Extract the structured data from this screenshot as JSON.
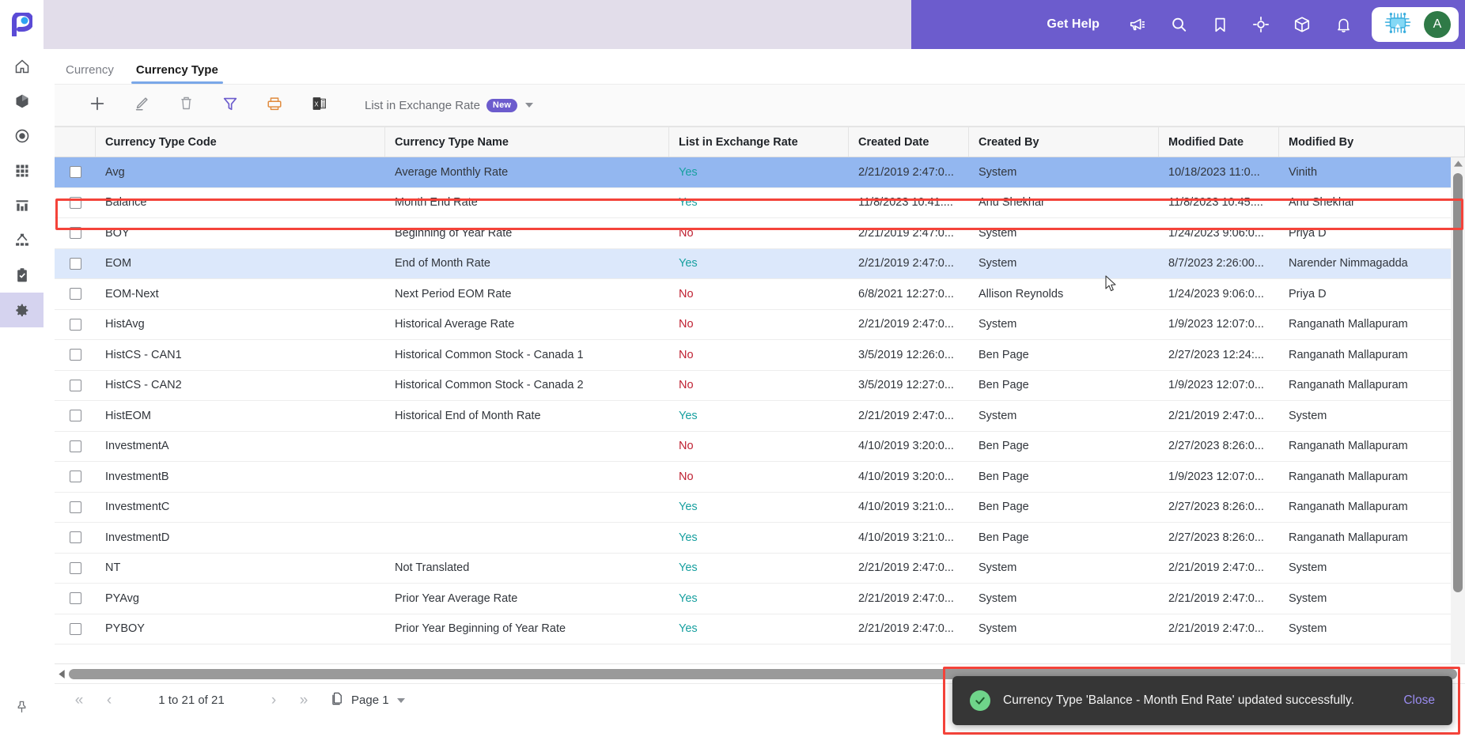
{
  "app": {
    "logo": "p-logo",
    "sidebar": {
      "items": [
        {
          "name": "home",
          "icon": "home-icon"
        },
        {
          "name": "cube",
          "icon": "cube-icon"
        },
        {
          "name": "target",
          "icon": "target-icon"
        },
        {
          "name": "grid",
          "icon": "grid-icon"
        },
        {
          "name": "reports",
          "icon": "bar-chart-icon"
        },
        {
          "name": "hierarchy",
          "icon": "hierarchy-icon"
        },
        {
          "name": "tasks",
          "icon": "clipboard-check-icon"
        },
        {
          "name": "settings",
          "icon": "gear-icon",
          "active": true
        }
      ],
      "pin": "pin-icon"
    }
  },
  "header": {
    "get_help": "Get Help",
    "icons": [
      "megaphone-icon",
      "search-icon",
      "bookmark-icon",
      "target-crosshair-icon",
      "box-icon",
      "bell-icon"
    ],
    "assistant_icon": "ai-chip-icon",
    "avatar_initial": "A",
    "accent": "#6c5ccd",
    "band": "#e2ddea",
    "avatar_color": "#2f7a47"
  },
  "tabs": [
    {
      "label": "Currency",
      "active": false
    },
    {
      "label": "Currency Type",
      "active": true
    }
  ],
  "toolbar": {
    "buttons": [
      {
        "name": "add",
        "icon": "plus-icon"
      },
      {
        "name": "edit",
        "icon": "pencil-icon"
      },
      {
        "name": "delete",
        "icon": "trash-icon"
      },
      {
        "name": "filter",
        "icon": "funnel-icon"
      },
      {
        "name": "print",
        "icon": "printer-icon"
      },
      {
        "name": "export-excel",
        "icon": "excel-icon"
      }
    ],
    "view_label": "List in Exchange Rate",
    "view_badge": "New"
  },
  "grid": {
    "columns": [
      {
        "key": "check",
        "label": ""
      },
      {
        "key": "code",
        "label": "Currency Type Code"
      },
      {
        "key": "name",
        "label": "Currency Type Name"
      },
      {
        "key": "list",
        "label": "List in Exchange Rate"
      },
      {
        "key": "cdate",
        "label": "Created Date"
      },
      {
        "key": "cby",
        "label": "Created By"
      },
      {
        "key": "mdate",
        "label": "Modified Date"
      },
      {
        "key": "mby",
        "label": "Modified By"
      }
    ],
    "rows": [
      {
        "code": "Avg",
        "name": "Average Monthly Rate",
        "list": "Yes",
        "cdate": "2/21/2019 2:47:0...",
        "cby": "System",
        "mdate": "10/18/2023 11:0...",
        "mby": "Vinith",
        "state": "selected-strong"
      },
      {
        "code": "Balance",
        "name": "Month End Rate",
        "list": "Yes",
        "cdate": "11/8/2023 10:41:...",
        "cby": "Anu Shekhar",
        "mdate": "11/8/2023 10:45:...",
        "mby": "Anu Shekhar",
        "state": "highlighted"
      },
      {
        "code": "BOY",
        "name": "Beginning of Year Rate",
        "list": "No",
        "cdate": "2/21/2019 2:47:0...",
        "cby": "System",
        "mdate": "1/24/2023 9:06:0...",
        "mby": "Priya D",
        "state": "normal"
      },
      {
        "code": "EOM",
        "name": "End of Month Rate",
        "list": "Yes",
        "cdate": "2/21/2019 2:47:0...",
        "cby": "System",
        "mdate": "8/7/2023 2:26:00...",
        "mby": "Narender Nimmagadda",
        "state": "selected-light"
      },
      {
        "code": "EOM-Next",
        "name": "Next Period EOM Rate",
        "list": "No",
        "cdate": "6/8/2021 12:27:0...",
        "cby": "Allison Reynolds",
        "mdate": "1/24/2023 9:06:0...",
        "mby": "Priya D",
        "state": "normal"
      },
      {
        "code": "HistAvg",
        "name": "Historical Average Rate",
        "list": "No",
        "cdate": "2/21/2019 2:47:0...",
        "cby": "System",
        "mdate": "1/9/2023 12:07:0...",
        "mby": "Ranganath Mallapuram",
        "state": "normal"
      },
      {
        "code": "HistCS - CAN1",
        "name": "Historical Common Stock - Canada 1",
        "list": "No",
        "cdate": "3/5/2019 12:26:0...",
        "cby": "Ben Page",
        "mdate": "2/27/2023 12:24:...",
        "mby": "Ranganath Mallapuram",
        "state": "normal"
      },
      {
        "code": "HistCS - CAN2",
        "name": "Historical Common Stock - Canada 2",
        "list": "No",
        "cdate": "3/5/2019 12:27:0...",
        "cby": "Ben Page",
        "mdate": "1/9/2023 12:07:0...",
        "mby": "Ranganath Mallapuram",
        "state": "normal"
      },
      {
        "code": "HistEOM",
        "name": "Historical End of Month Rate",
        "list": "Yes",
        "cdate": "2/21/2019 2:47:0...",
        "cby": "System",
        "mdate": "2/21/2019 2:47:0...",
        "mby": "System",
        "state": "normal"
      },
      {
        "code": "InvestmentA",
        "name": "",
        "list": "No",
        "cdate": "4/10/2019 3:20:0...",
        "cby": "Ben Page",
        "mdate": "2/27/2023 8:26:0...",
        "mby": "Ranganath Mallapuram",
        "state": "normal"
      },
      {
        "code": "InvestmentB",
        "name": "",
        "list": "No",
        "cdate": "4/10/2019 3:20:0...",
        "cby": "Ben Page",
        "mdate": "1/9/2023 12:07:0...",
        "mby": "Ranganath Mallapuram",
        "state": "normal"
      },
      {
        "code": "InvestmentC",
        "name": "",
        "list": "Yes",
        "cdate": "4/10/2019 3:21:0...",
        "cby": "Ben Page",
        "mdate": "2/27/2023 8:26:0...",
        "mby": "Ranganath Mallapuram",
        "state": "normal"
      },
      {
        "code": "InvestmentD",
        "name": "",
        "list": "Yes",
        "cdate": "4/10/2019 3:21:0...",
        "cby": "Ben Page",
        "mdate": "2/27/2023 8:26:0...",
        "mby": "Ranganath Mallapuram",
        "state": "normal"
      },
      {
        "code": "NT",
        "name": "Not Translated",
        "list": "Yes",
        "cdate": "2/21/2019 2:47:0...",
        "cby": "System",
        "mdate": "2/21/2019 2:47:0...",
        "mby": "System",
        "state": "normal"
      },
      {
        "code": "PYAvg",
        "name": "Prior Year Average Rate",
        "list": "Yes",
        "cdate": "2/21/2019 2:47:0...",
        "cby": "System",
        "mdate": "2/21/2019 2:47:0...",
        "mby": "System",
        "state": "normal"
      },
      {
        "code": "PYBOY",
        "name": "Prior Year Beginning of Year Rate",
        "list": "Yes",
        "cdate": "2/21/2019 2:47:0...",
        "cby": "System",
        "mdate": "2/21/2019 2:47:0...",
        "mby": "System",
        "state": "normal"
      }
    ]
  },
  "pager": {
    "first": "«",
    "prev": "‹",
    "range": "1 to 21 of 21",
    "next": "›",
    "last": "»",
    "page_label": "Page 1"
  },
  "toast": {
    "message": "Currency Type 'Balance - Month End Rate' updated successfully.",
    "close": "Close",
    "check_icon": "check-circle-icon",
    "bg": "#363636",
    "close_color": "#9a8cf0"
  },
  "annotations": {
    "row_box_color": "#f4433a",
    "toast_box_color": "#f4433a"
  }
}
